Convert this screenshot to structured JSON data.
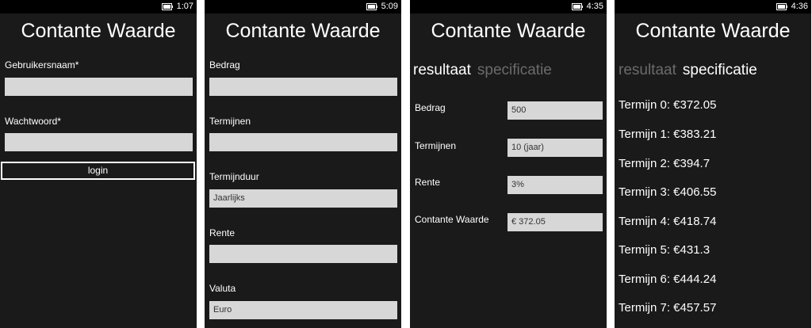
{
  "app_title": "Contante Waarde",
  "screens": [
    {
      "time": "1:07",
      "username_label": "Gebruikersnaam*",
      "password_label": "Wachtwoord*",
      "login_label": "login"
    },
    {
      "time": "5:09",
      "fields": [
        {
          "label": "Bedrag",
          "value": ""
        },
        {
          "label": "Termijnen",
          "value": ""
        },
        {
          "label": "Termijnduur",
          "value": "Jaarlijks"
        },
        {
          "label": "Rente",
          "value": ""
        },
        {
          "label": "Valuta",
          "value": "Euro"
        }
      ]
    },
    {
      "time": "4:35",
      "pivot": {
        "active": "resultaat",
        "inactive": "specificatie"
      },
      "results": [
        {
          "label": "Bedrag",
          "value": "500"
        },
        {
          "label": "Termijnen",
          "value": "10 (jaar)"
        },
        {
          "label": "Rente",
          "value": "3%"
        },
        {
          "label": "Contante Waarde",
          "value": "€ 372.05"
        }
      ]
    },
    {
      "time": "4:36",
      "pivot": {
        "inactive": "resultaat",
        "active": "specificatie"
      },
      "terms": [
        "Termijn 0: €372.05",
        "Termijn 1: €383.21",
        "Termijn 2: €394.7",
        "Termijn 3: €406.55",
        "Termijn 4: €418.74",
        "Termijn 5: €431.3",
        "Termijn 6: €444.24",
        "Termijn 7: €457.57"
      ]
    }
  ],
  "colors": {
    "screen_bg": "#1a1a1a",
    "field_bg": "#d7d7d7",
    "inactive_pivot": "#6b6b6b"
  },
  "icons": {
    "status": "battery-icon"
  }
}
